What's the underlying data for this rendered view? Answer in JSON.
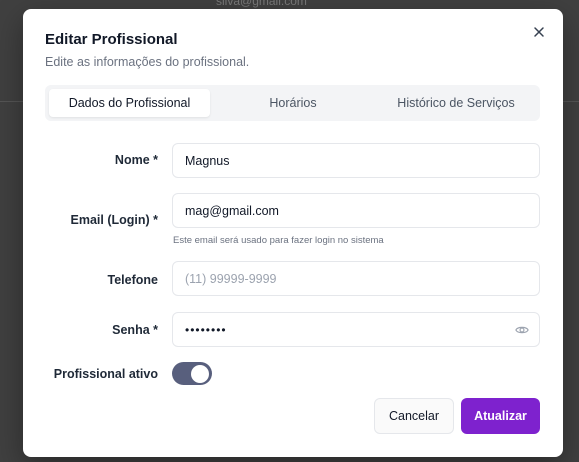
{
  "background": {
    "email_text": "silva@gmail.com"
  },
  "dialog": {
    "title": "Editar Profissional",
    "description": "Edite as informações do profissional.",
    "close_icon": "close-icon"
  },
  "tabs": [
    {
      "label": "Dados do Profissional",
      "active": true
    },
    {
      "label": "Horários",
      "active": false
    },
    {
      "label": "Histórico de Serviços",
      "active": false
    }
  ],
  "form": {
    "name": {
      "label": "Nome *",
      "value": "Magnus"
    },
    "email": {
      "label": "Email (Login) *",
      "value": "mag@gmail.com",
      "hint": "Este email será usado para fazer login no sistema"
    },
    "phone": {
      "label": "Telefone",
      "placeholder": "(11) 99999-9999"
    },
    "password": {
      "label": "Senha *",
      "value": "••••••••",
      "icon": "eye-icon"
    },
    "active": {
      "label": "Profissional ativo",
      "checked": true
    }
  },
  "actions": {
    "cancel_label": "Cancelar",
    "submit_label": "Atualizar"
  },
  "colors": {
    "accent": "#7e22ce",
    "toggle_on": "#585f7d"
  }
}
